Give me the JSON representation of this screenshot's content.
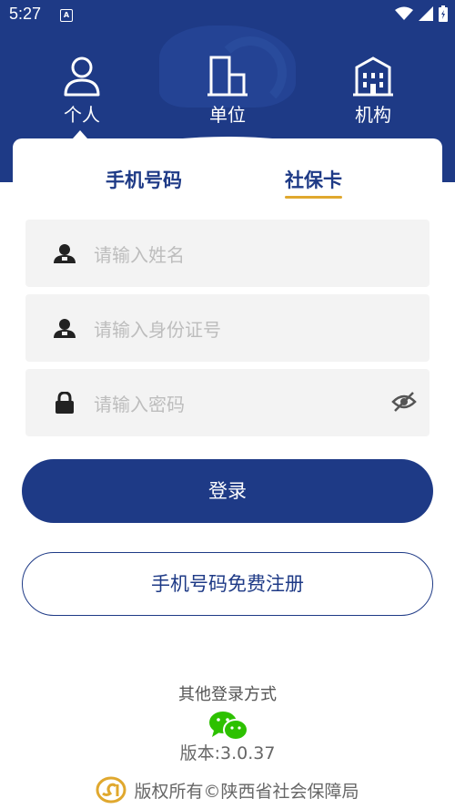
{
  "status_bar": {
    "time": "5:27",
    "app_icon": "A"
  },
  "user_types": [
    {
      "label": "个人",
      "icon": "person-icon",
      "selected": true
    },
    {
      "label": "单位",
      "icon": "building-icon",
      "selected": false
    },
    {
      "label": "机构",
      "icon": "institution-icon",
      "selected": false
    }
  ],
  "login_tabs": [
    {
      "label": "手机号码",
      "selected": false
    },
    {
      "label": "社保卡",
      "selected": true
    }
  ],
  "form": {
    "name_placeholder": "请输入姓名",
    "id_placeholder": "请输入身份证号",
    "password_placeholder": "请输入密码"
  },
  "login_button": "登录",
  "register_button": "手机号码免费注册",
  "other_login": "其他登录方式",
  "version": "版本:3.0.37",
  "copyright": "版权所有©陕西省社会保障局",
  "colors": {
    "primary": "#1e3a86",
    "accent": "#e0a82e",
    "wechat": "#2dc100"
  }
}
